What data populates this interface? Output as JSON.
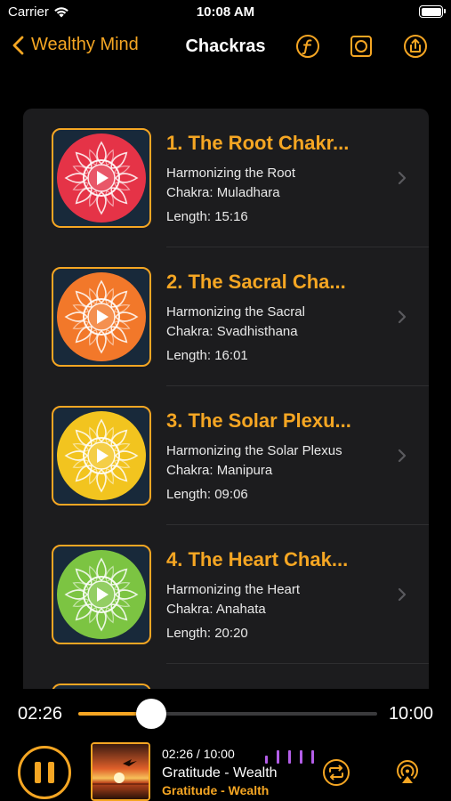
{
  "status_bar": {
    "carrier": "Carrier",
    "time": "10:08 AM"
  },
  "nav": {
    "back_label": "Wealthy Mind",
    "title": "Chackras"
  },
  "colors": {
    "accent": "#f5a623",
    "card": "#1c1c1e",
    "background": "#000000",
    "equalizer": "#b45ee8"
  },
  "icons": [
    "chevron-left-icon",
    "font-icon",
    "square-icon",
    "share-icon",
    "chevron-right-icon",
    "pause-icon",
    "repeat-icon",
    "airplay-icon",
    "wifi-icon",
    "battery-icon"
  ],
  "tracks": [
    {
      "title": "1. The Root Chakr...",
      "subtitle_line1": "Harmonizing the Root",
      "subtitle_line2": "Chakra: Muladhara",
      "length": "Length: 15:16",
      "color": "#e53347"
    },
    {
      "title": "2. The Sacral Cha...",
      "subtitle_line1": "Harmonizing the Sacral",
      "subtitle_line2": "Chakra: Svadhisthana",
      "length": "Length: 16:01",
      "color": "#f2782a"
    },
    {
      "title": "3. The Solar Plexu...",
      "subtitle_line1": "Harmonizing the Solar Plexus",
      "subtitle_line2": "Chakra: Manipura",
      "length": "Length: 09:06",
      "color": "#f2c41f"
    },
    {
      "title": "4. The Heart Chak...",
      "subtitle_line1": "Harmonizing the Heart",
      "subtitle_line2": "Chakra: Anahata",
      "length": "Length: 20:20",
      "color": "#7cc442"
    }
  ],
  "player": {
    "elapsed": "02:26",
    "total": "10:00",
    "progress": 0.243,
    "now_playing_time": "02:26 /  10:00",
    "now_playing_title": "Gratitude - Wealth",
    "now_playing_subtitle": "Gratitude - Wealth"
  }
}
